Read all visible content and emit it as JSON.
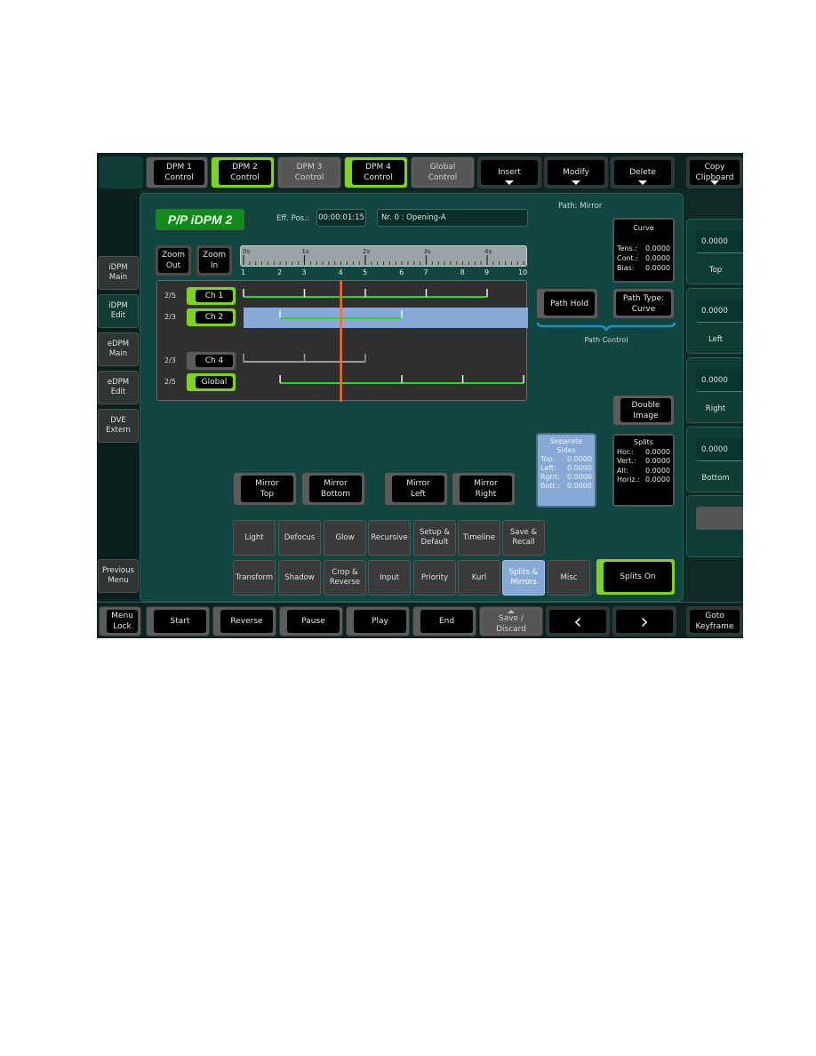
{
  "top_bar": {
    "tabs": [
      {
        "label": "DPM 1\nControl",
        "state": "normal"
      },
      {
        "label": "DPM 2\nControl",
        "state": "active"
      },
      {
        "label": "DPM 3\nControl",
        "state": "gray"
      },
      {
        "label": "DPM 4\nControl",
        "state": "active"
      },
      {
        "label": "Global\nControl",
        "state": "gray"
      }
    ],
    "menus": [
      {
        "label": "Insert"
      },
      {
        "label": "Modify"
      },
      {
        "label": "Delete"
      },
      {
        "label": "Copy\nClipboard"
      }
    ]
  },
  "sidebar": {
    "items": [
      {
        "label": "iDPM\nMain",
        "active": false
      },
      {
        "label": "iDPM\nEdit",
        "active": true
      },
      {
        "label": "eDPM\nMain",
        "active": false
      },
      {
        "label": "eDPM\nEdit",
        "active": false
      },
      {
        "label": "DVE\nExtern",
        "active": false
      }
    ],
    "previous_menu": "Previous\nMenu"
  },
  "header": {
    "title": "P/P iDPM 2",
    "eff_pos_label": "Eff. Pos.:",
    "eff_pos_value": "00:00:01:15",
    "keyframe_name": "Nr. 0 :  Opening-A",
    "path_label": "Path: Mirror"
  },
  "zoom": {
    "out_label": "Zoom\nOut",
    "in_label": "Zoom\nIn"
  },
  "ruler": {
    "seconds": [
      "0s",
      "1s",
      "2s",
      "3s",
      "4s"
    ],
    "keyframes": [
      "1",
      "2",
      "3",
      "4",
      "5",
      "6",
      "7",
      "8",
      "9",
      "10"
    ],
    "keyframe_positions": [
      0,
      0.6,
      1.0,
      1.6,
      2.0,
      2.6,
      3.0,
      3.6,
      4.0,
      4.6
    ]
  },
  "timeline": {
    "playhead_seconds": 1.6,
    "channels": [
      {
        "ratio": "2/5",
        "label": "Ch 1",
        "active": true,
        "keyframes": [
          0,
          1.0,
          2.0,
          3.0,
          4.0
        ],
        "selected": false
      },
      {
        "ratio": "2/3",
        "label": "Ch 2",
        "active": true,
        "keyframes": [
          0.6,
          1.6,
          2.6
        ],
        "selected": true
      },
      {
        "ratio": "2/3",
        "label": "Ch 4",
        "active": false,
        "keyframes": [
          0,
          1.0,
          2.0
        ],
        "selected": false
      },
      {
        "ratio": "2/5",
        "label": "Global",
        "active": true,
        "keyframes": [
          0.6,
          1.6,
          2.6,
          3.6,
          4.6
        ],
        "selected": false
      }
    ]
  },
  "curve_box": {
    "title": "Curve",
    "rows": [
      {
        "k": "Tens.:",
        "v": "0.0000"
      },
      {
        "k": "Cont.:",
        "v": "0.0000"
      },
      {
        "k": "Bias:",
        "v": "0.0000"
      }
    ]
  },
  "path_control": {
    "hold_label": "Path Hold",
    "type_label": "Path Type:\nCurve",
    "group_label": "Path Control"
  },
  "right_panel": [
    {
      "value": "0.0000",
      "label": "Top"
    },
    {
      "value": "0.0000",
      "label": "Left"
    },
    {
      "value": "0.0000",
      "label": "Right"
    },
    {
      "value": "0.0000",
      "label": "Bottom"
    },
    {
      "value": "",
      "label": ""
    }
  ],
  "double_image": "Double\nImage",
  "separate_sides": {
    "title": "Separate\nSides",
    "rows": [
      {
        "k": "Top:",
        "v": "0.0000"
      },
      {
        "k": "Left:",
        "v": "0.0000"
      },
      {
        "k": "Rght:",
        "v": "0.0000"
      },
      {
        "k": "Bott.:",
        "v": "0.0000"
      }
    ]
  },
  "splits": {
    "title": "Splits",
    "rows": [
      {
        "k": "Hor.:",
        "v": "0.0000"
      },
      {
        "k": "Vert.:",
        "v": "0.0000"
      },
      {
        "k": "All:",
        "v": "0.0000"
      },
      {
        "k": "Horiz.:",
        "v": "0.0000"
      }
    ]
  },
  "mirror_buttons": [
    "Mirror\nTop",
    "Mirror\nBottom",
    "Mirror\nLeft",
    "Mirror\nRight"
  ],
  "effect_menu": {
    "row1": [
      "Light",
      "Defocus",
      "Glow",
      "Recursive",
      "Setup &\nDefault",
      "Timeline",
      "Save &\nRecall"
    ],
    "row2": [
      "Transform",
      "Shadow",
      "Crop &\nReverse",
      "Input",
      "Priority",
      "Kurl",
      "Splits &\nMirrors",
      "Misc"
    ],
    "selected": "Splits &\nMirrors"
  },
  "splits_on": "Splits On",
  "bottom_bar": {
    "menu_lock": "Menu\nLock",
    "start": "Start",
    "reverse": "Reverse",
    "pause": "Pause",
    "play": "Play",
    "end": "End",
    "save_discard": "Save /\nDiscard",
    "prev": "‹",
    "next": "›",
    "goto_keyframe": "Goto\nKeyframe"
  },
  "colors": {
    "active_green": "#7ed321",
    "track_green": "#22dd22",
    "playhead": "#ff6a2a",
    "selection_blue": "#86a9d6",
    "title_green": "#118a1a"
  }
}
